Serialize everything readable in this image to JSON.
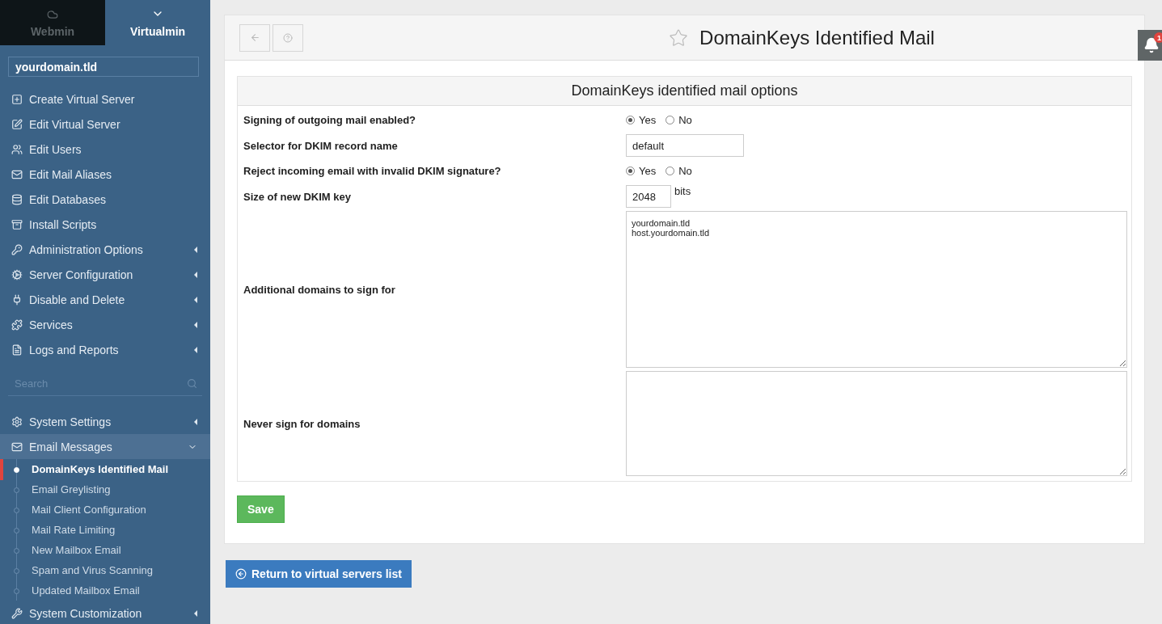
{
  "switcher": [
    {
      "label": "Webmin",
      "selected": false
    },
    {
      "label": "Virtualmin",
      "selected": true
    }
  ],
  "domain_field": {
    "value": "yourdomain.tld"
  },
  "menu_top": [
    {
      "label": "Create Virtual Server",
      "kind": "link"
    },
    {
      "label": "Edit Virtual Server",
      "kind": "link"
    },
    {
      "label": "Edit Users",
      "kind": "link"
    },
    {
      "label": "Edit Mail Aliases",
      "kind": "link"
    },
    {
      "label": "Edit Databases",
      "kind": "link"
    },
    {
      "label": "Install Scripts",
      "kind": "link"
    },
    {
      "label": "Administration Options",
      "kind": "group",
      "expanded": false
    },
    {
      "label": "Server Configuration",
      "kind": "group",
      "expanded": false
    },
    {
      "label": "Disable and Delete",
      "kind": "group",
      "expanded": false
    },
    {
      "label": "Services",
      "kind": "group",
      "expanded": false
    },
    {
      "label": "Logs and Reports",
      "kind": "group",
      "expanded": false
    }
  ],
  "search": {
    "placeholder": "Search"
  },
  "menu_bottom": [
    {
      "label": "System Settings",
      "kind": "group",
      "expanded": false
    },
    {
      "label": "Email Messages",
      "kind": "group",
      "expanded": true,
      "children": [
        {
          "label": "DomainKeys Identified Mail",
          "selected": true
        },
        {
          "label": "Email Greylisting",
          "selected": false
        },
        {
          "label": "Mail Client Configuration",
          "selected": false
        },
        {
          "label": "Mail Rate Limiting",
          "selected": false
        },
        {
          "label": "New Mailbox Email",
          "selected": false
        },
        {
          "label": "Spam and Virus Scanning",
          "selected": false
        },
        {
          "label": "Updated Mailbox Email",
          "selected": false
        }
      ]
    },
    {
      "label": "System Customization",
      "kind": "group",
      "expanded": false
    }
  ],
  "page": {
    "title": "DomainKeys Identified Mail",
    "favorite": false
  },
  "notifications": {
    "count": "1"
  },
  "form": {
    "heading": "DomainKeys identified mail options",
    "rows": [
      {
        "label": "Signing of outgoing mail enabled?",
        "kind": "radio",
        "options": [
          {
            "label": "Yes",
            "selected": true
          },
          {
            "label": "No",
            "selected": false
          }
        ]
      },
      {
        "label": "Selector for DKIM record name",
        "kind": "text",
        "value": "default"
      },
      {
        "label": "Reject incoming email with invalid DKIM signature?",
        "kind": "radio",
        "options": [
          {
            "label": "Yes",
            "selected": true
          },
          {
            "label": "No",
            "selected": false
          }
        ]
      },
      {
        "label": "Size of new DKIM key",
        "kind": "number",
        "value": "2048",
        "unit": "bits"
      },
      {
        "label": "Additional domains to sign for",
        "kind": "textarea",
        "value": "yourdomain.tld\nhost.yourdomain.tld",
        "tall": true
      },
      {
        "label": "Never sign for domains",
        "kind": "textarea",
        "value": "",
        "tall": false
      }
    ]
  },
  "save_button": "Save",
  "return_button": "Return to virtual servers list"
}
